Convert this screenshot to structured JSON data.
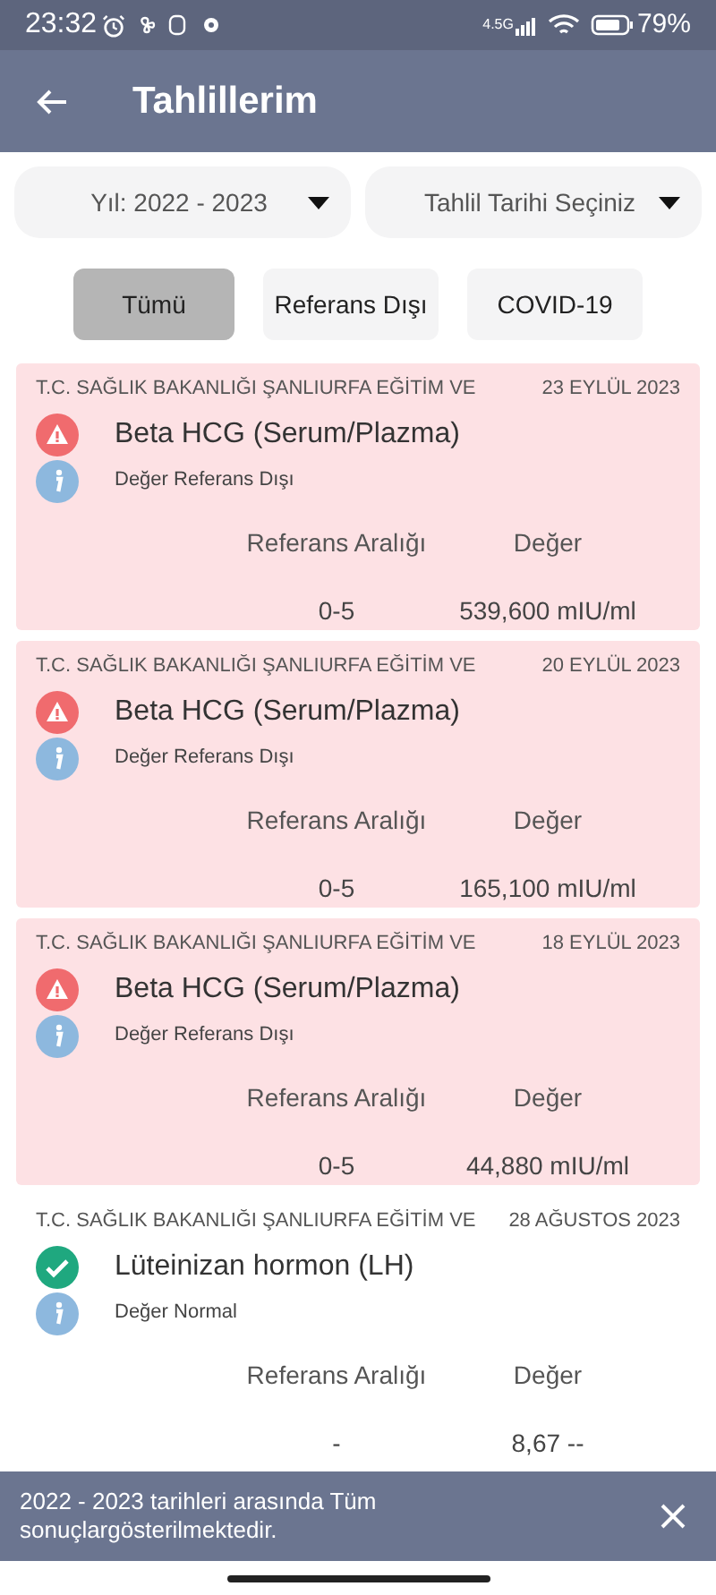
{
  "status_bar": {
    "time": "23:32",
    "network": "4.5G",
    "battery": "79%"
  },
  "app_bar": {
    "title": "Tahlillerim"
  },
  "filters": [
    {
      "label": "Yıl: 2022 - 2023"
    },
    {
      "label": "Tahlil Tarihi Seçiniz"
    }
  ],
  "tabs": [
    {
      "label": "Tümü",
      "selected": true
    },
    {
      "label": "Referans Dışı",
      "selected": false
    },
    {
      "label": "COVID-19",
      "selected": false
    }
  ],
  "results": [
    {
      "kind": "abnormal",
      "hospital": "T.C. SAĞLIK BAKANLIĞI ŞANLIURFA EĞİTİM VE",
      "date": "23 EYLÜL 2023",
      "test": "Beta HCG (Serum/Plazma)",
      "status": "Değer Referans Dışı",
      "range_label": "Referans Aralığı",
      "value_label": "Değer",
      "range": "0-5",
      "value": "539,600 mIU/ml"
    },
    {
      "kind": "abnormal",
      "hospital": "T.C. SAĞLIK BAKANLIĞI ŞANLIURFA EĞİTİM VE",
      "date": "20 EYLÜL 2023",
      "test": "Beta HCG (Serum/Plazma)",
      "status": "Değer Referans Dışı",
      "range_label": "Referans Aralığı",
      "value_label": "Değer",
      "range": "0-5",
      "value": "165,100 mIU/ml"
    },
    {
      "kind": "abnormal",
      "hospital": "T.C. SAĞLIK BAKANLIĞI ŞANLIURFA EĞİTİM VE",
      "date": "18 EYLÜL 2023",
      "test": "Beta HCG (Serum/Plazma)",
      "status": "Değer Referans Dışı",
      "range_label": "Referans Aralığı",
      "value_label": "Değer",
      "range": "0-5",
      "value": "44,880 mIU/ml"
    },
    {
      "kind": "normal",
      "hospital": "T.C. SAĞLIK BAKANLIĞI ŞANLIURFA EĞİTİM VE",
      "date": "28 AĞUSTOS 2023",
      "test": "Lüteinizan hormon (LH)",
      "status": "Değer Normal",
      "range_label": "Referans Aralığı",
      "value_label": "Değer",
      "range": "-",
      "value": "8,67 --"
    }
  ],
  "snackbar": {
    "message": "2022 - 2023 tarihleri arasında Tüm sonuçlargösterilmektedir."
  }
}
